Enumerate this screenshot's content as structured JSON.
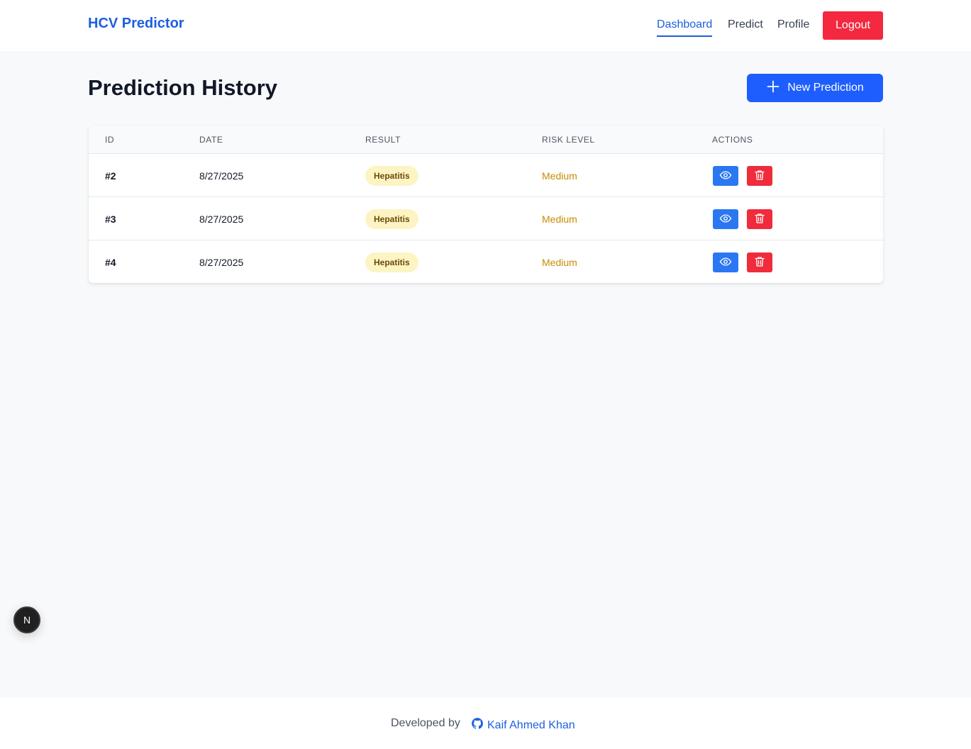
{
  "nav": {
    "brand": "HCV Predictor",
    "links": [
      {
        "label": "Dashboard",
        "active": true
      },
      {
        "label": "Predict",
        "active": false
      },
      {
        "label": "Profile",
        "active": false
      }
    ],
    "logout_label": "Logout"
  },
  "header": {
    "title": "Prediction History",
    "new_button_label": "New Prediction",
    "new_button_icon": "plus-icon"
  },
  "table": {
    "columns": [
      "ID",
      "DATE",
      "RESULT",
      "RISK LEVEL",
      "ACTIONS"
    ],
    "rows": [
      {
        "id": "#2",
        "date": "8/27/2025",
        "result": "Hepatitis",
        "risk": "Medium"
      },
      {
        "id": "#3",
        "date": "8/27/2025",
        "result": "Hepatitis",
        "risk": "Medium"
      },
      {
        "id": "#4",
        "date": "8/27/2025",
        "result": "Hepatitis",
        "risk": "Medium"
      }
    ],
    "action_icons": [
      "eye-icon",
      "trash-icon"
    ]
  },
  "next_indicator": "N",
  "footer": {
    "text": "Developed by",
    "author": "Kaif Ahmed Khan",
    "author_icon": "github-icon"
  },
  "colors": {
    "brand": "#1d5fe0",
    "primary_button": "#1e5eff",
    "danger": "#f4283e",
    "view_button": "#2b77f2",
    "badge_bg": "#fdf4c3",
    "risk_medium": "#c98a04"
  }
}
